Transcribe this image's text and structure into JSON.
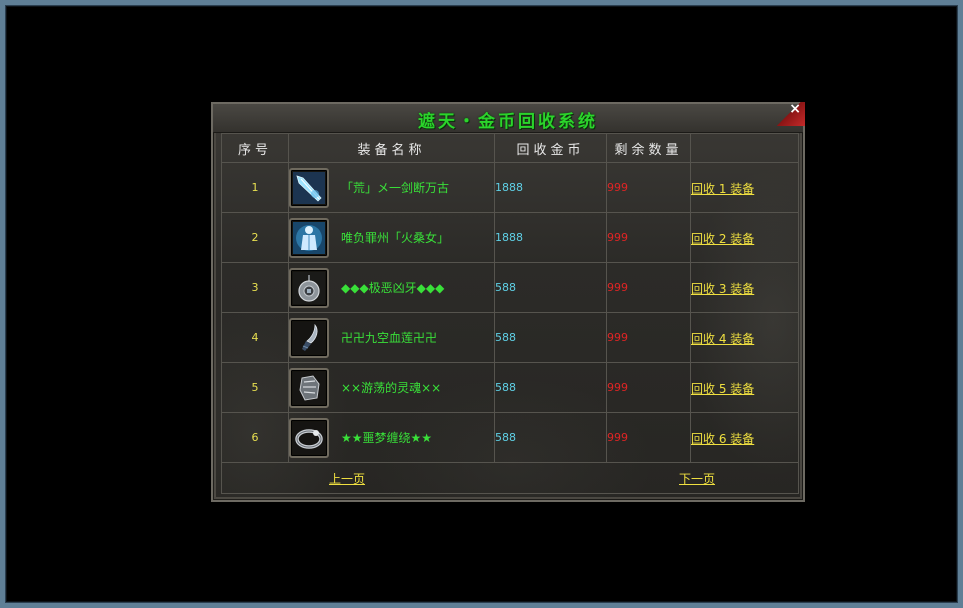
{
  "dialog": {
    "title": "遮天・金币回收系统",
    "close_label": "×"
  },
  "table": {
    "headers": {
      "index": "序号",
      "name": "装备名称",
      "gold": "回收金币",
      "remaining": "剩余数量",
      "action": ""
    },
    "rows": [
      {
        "index": "1",
        "name": "「荒」メ一剑断万古",
        "icon": "ice-sword-icon",
        "gold": "1888",
        "remaining": "999",
        "action": "回收 1 装备"
      },
      {
        "index": "2",
        "name": "唯负罪州「火桑女」",
        "icon": "ice-armor-icon",
        "gold": "1888",
        "remaining": "999",
        "action": "回收 2 装备"
      },
      {
        "index": "3",
        "name": "◆◆◆极恶凶牙◆◆◆",
        "icon": "amulet-icon",
        "gold": "588",
        "remaining": "999",
        "action": "回收 3 装备"
      },
      {
        "index": "4",
        "name": "卍卍九空血莲卍卍",
        "icon": "dagger-icon",
        "gold": "588",
        "remaining": "999",
        "action": "回收 4 装备"
      },
      {
        "index": "5",
        "name": "××游荡的灵魂××",
        "icon": "gauntlet-icon",
        "gold": "588",
        "remaining": "999",
        "action": "回收 5 装备"
      },
      {
        "index": "6",
        "name": "★★噩梦缠绕★★",
        "icon": "ring-icon",
        "gold": "588",
        "remaining": "999",
        "action": "回收 6 装备"
      }
    ]
  },
  "pager": {
    "prev": "上一页",
    "next": "下一页"
  },
  "colors": {
    "title": "#2bd42b",
    "item_name": "#39e039",
    "index": "#e8e050",
    "gold": "#5fd0e6",
    "remaining": "#e02424",
    "link": "#f0e040",
    "frame": "#5f7f96"
  }
}
